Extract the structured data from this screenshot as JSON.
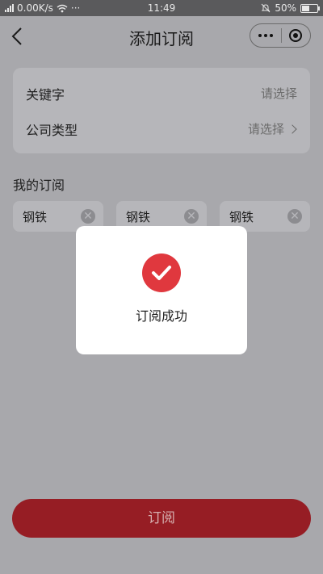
{
  "status_bar": {
    "network_speed": "0.00K/s",
    "more": "···",
    "time": "11:49",
    "battery": "50%",
    "battery_level": 0.5
  },
  "nav": {
    "title": "添加订阅",
    "back_icon": "chevron-left-icon",
    "more_icon": "more-dots-icon",
    "close_icon": "target-icon"
  },
  "filters": [
    {
      "label": "关键字",
      "value": "请选择",
      "has_chevron": false
    },
    {
      "label": "公司类型",
      "value": "请选择",
      "has_chevron": true
    }
  ],
  "my_subscriptions": {
    "title": "我的订阅",
    "tags": [
      {
        "label": "钢铁"
      },
      {
        "label": "钢铁"
      },
      {
        "label": "钢铁"
      }
    ],
    "remove_icon": "close-circle-icon"
  },
  "submit": {
    "label": "订阅"
  },
  "toast": {
    "text": "订阅成功",
    "icon": "check-circle-icon"
  },
  "colors": {
    "accent": "#961d24",
    "success_icon": "#e0383e",
    "overlay": "#a8a8ac"
  }
}
